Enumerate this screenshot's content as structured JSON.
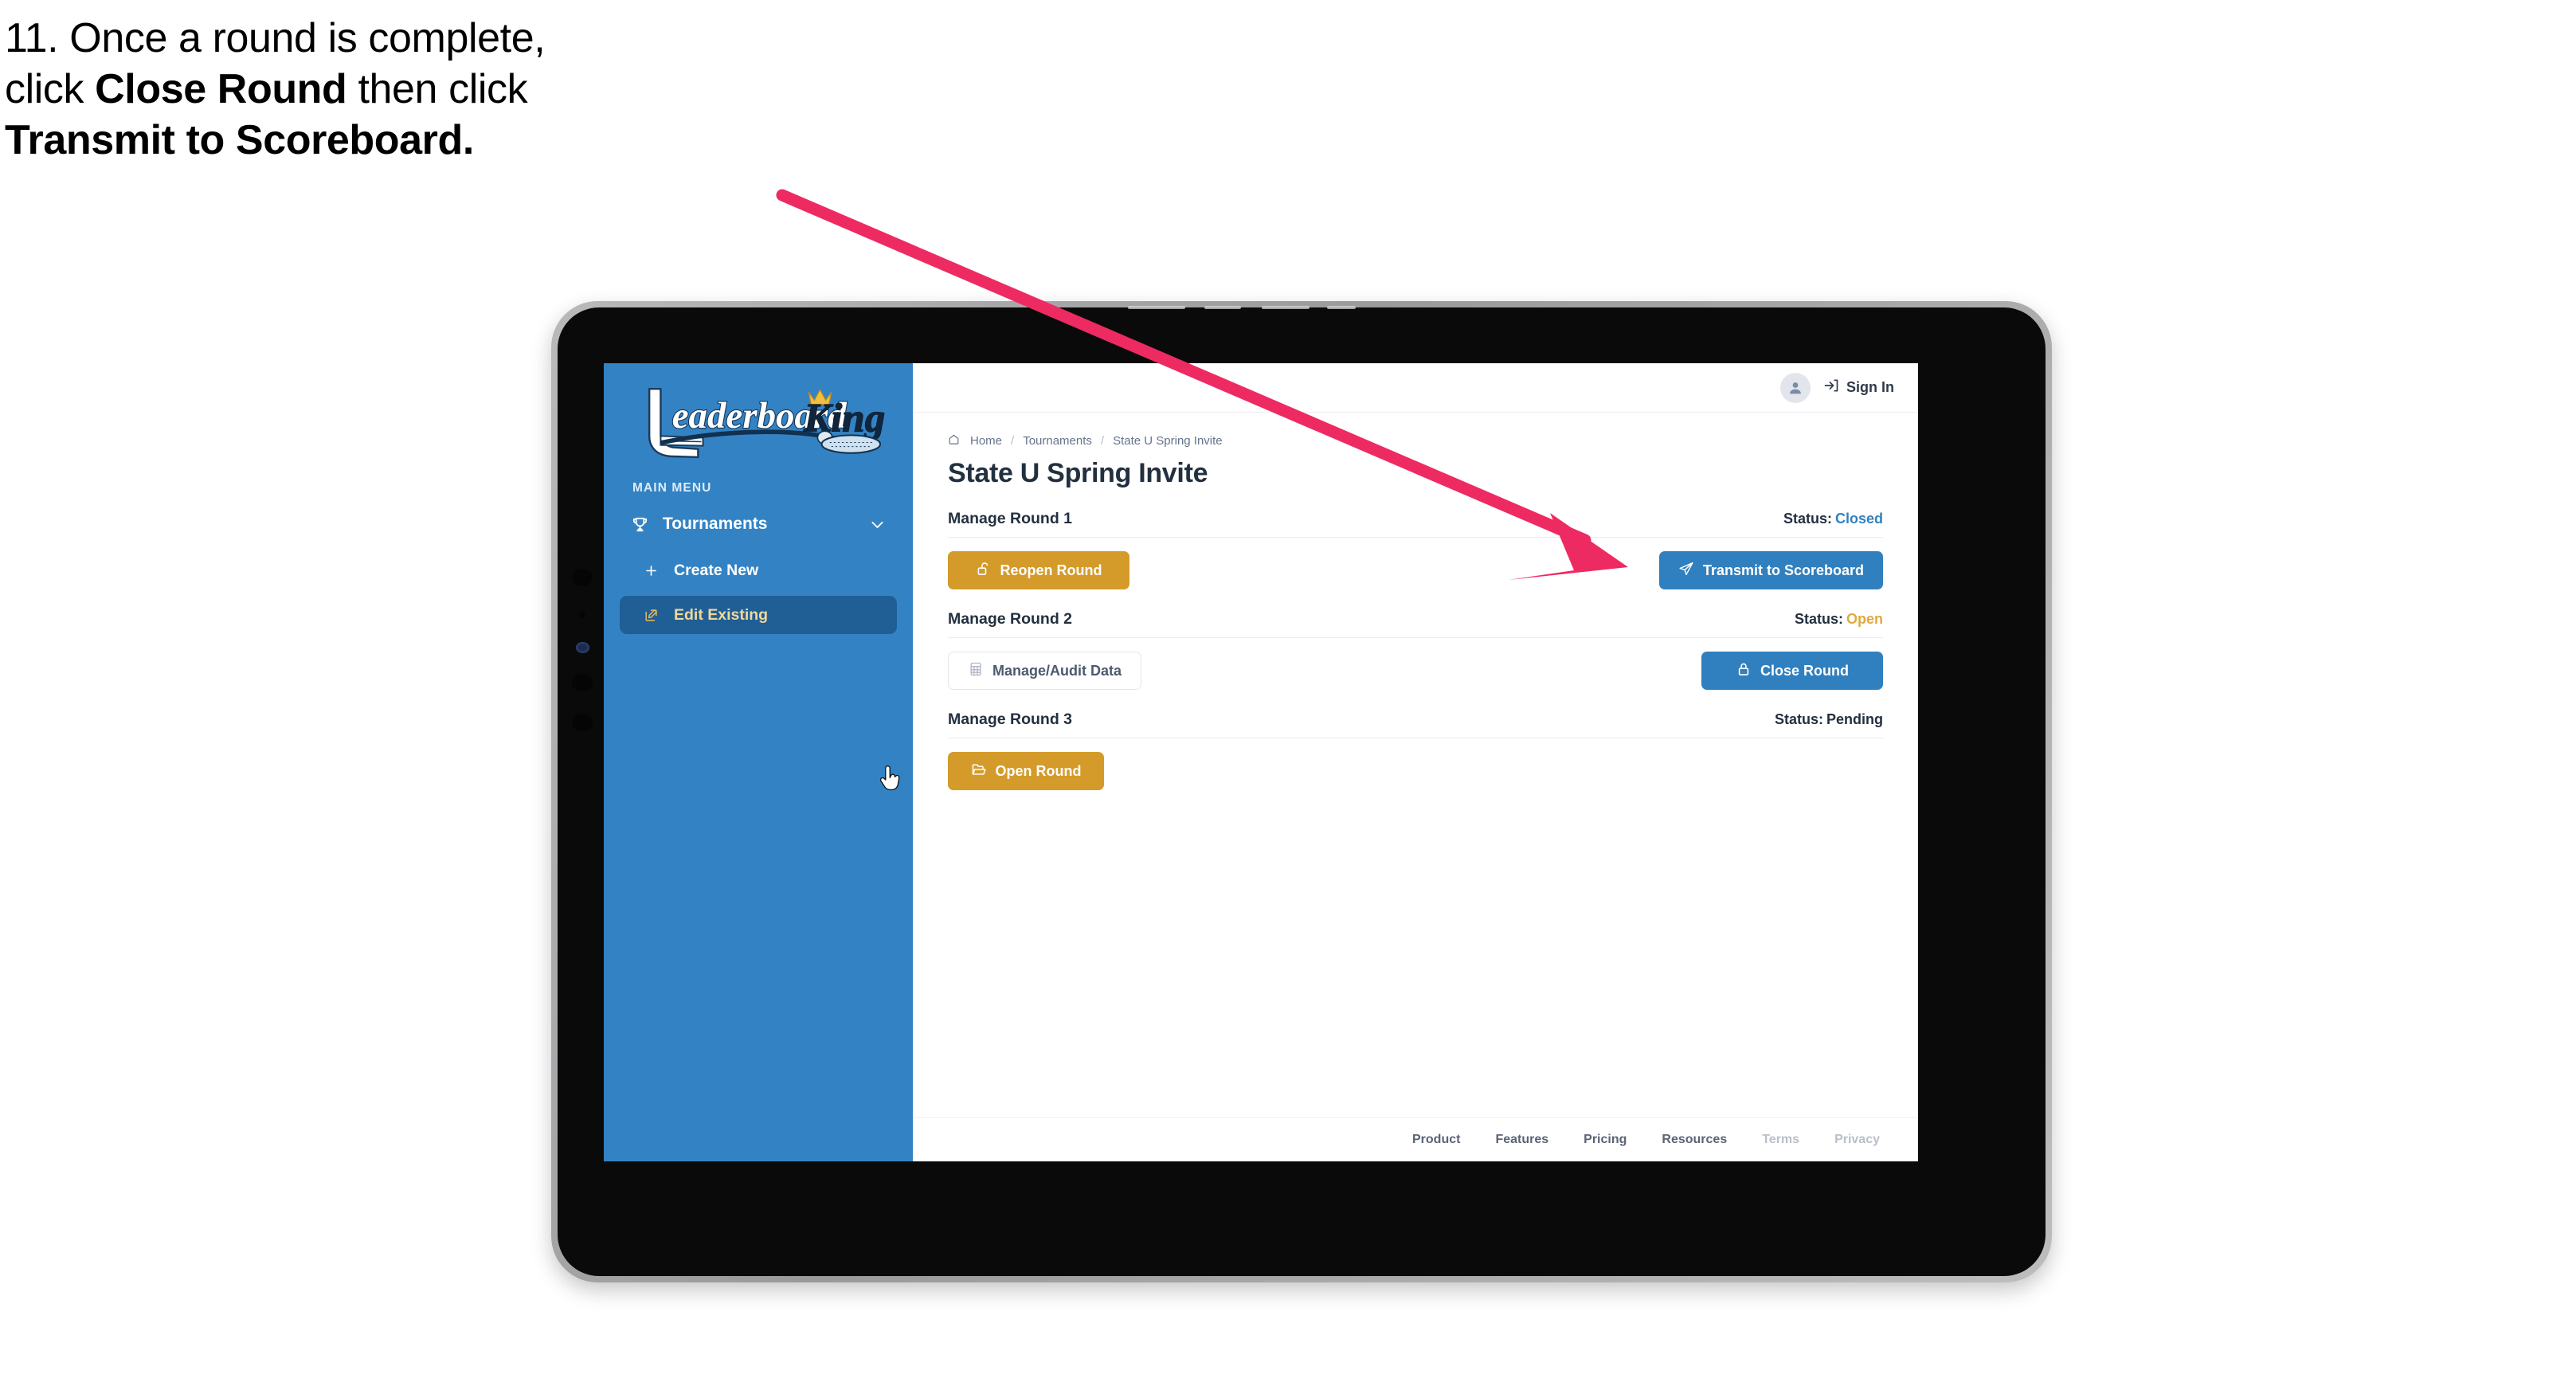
{
  "caption": {
    "line1": "11. Once a round is complete,",
    "line2_pre": "click ",
    "line2_bold": "Close Round",
    "line2_post": " then click",
    "line3_bold": "Transmit to Scoreboard."
  },
  "annotation": {
    "arrow_color": "#ee2a62",
    "points_to": "Transmit to Scoreboard"
  },
  "sidebar": {
    "logo": {
      "word1": "Leaderboard",
      "word2": "King",
      "icon": "golf-club-logo-icon"
    },
    "section_label": "MAIN MENU",
    "nav": {
      "label": "Tournaments",
      "icon": "trophy-icon",
      "chevron": "chevron-down-icon"
    },
    "sub_items": [
      {
        "label": "Create New",
        "icon": "plus-icon",
        "active": false
      },
      {
        "label": "Edit Existing",
        "icon": "pencil-square-icon",
        "active": true
      }
    ],
    "bg_color": "#3383c4",
    "active_bg_color": "#1f5f96",
    "active_text_color": "#f3d79a"
  },
  "topbar": {
    "avatar_icon": "user-avatar-icon",
    "signin_icon": "sign-in-arrow-icon",
    "signin_label": "Sign In"
  },
  "breadcrumb": {
    "home_icon": "home-icon",
    "items": [
      "Home",
      "Tournaments",
      "State U Spring Invite"
    ],
    "separator": "/"
  },
  "page_title": "State U Spring Invite",
  "status_colors": {
    "closed": "#3182bd",
    "open": "#e0a93f",
    "pending": "#22303f"
  },
  "rounds": [
    {
      "title": "Manage Round 1",
      "status_label": "Status:",
      "status_value": "Closed",
      "status_state": "closed",
      "left_button": {
        "label": "Reopen Round",
        "icon": "unlock-icon",
        "style": "gold"
      },
      "right_button": {
        "label": "Transmit to Scoreboard",
        "icon": "paper-plane-icon",
        "style": "blue"
      }
    },
    {
      "title": "Manage Round 2",
      "status_label": "Status:",
      "status_value": "Open",
      "status_state": "open",
      "left_button": {
        "label": "Manage/Audit Data",
        "icon": "table-grid-icon",
        "style": "ghost"
      },
      "right_button": {
        "label": "Close Round",
        "icon": "lock-icon",
        "style": "blue"
      }
    },
    {
      "title": "Manage Round 3",
      "status_label": "Status:",
      "status_value": "Pending",
      "status_state": "pending",
      "left_button": {
        "label": "Open Round",
        "icon": "open-folder-icon",
        "style": "gold"
      },
      "right_button": null
    }
  ],
  "footer": {
    "links": [
      {
        "label": "Product",
        "muted": false
      },
      {
        "label": "Features",
        "muted": false
      },
      {
        "label": "Pricing",
        "muted": false
      },
      {
        "label": "Resources",
        "muted": false
      },
      {
        "label": "Terms",
        "muted": true
      },
      {
        "label": "Privacy",
        "muted": true
      }
    ]
  },
  "cursor": {
    "type": "pointer-hand-cursor"
  }
}
